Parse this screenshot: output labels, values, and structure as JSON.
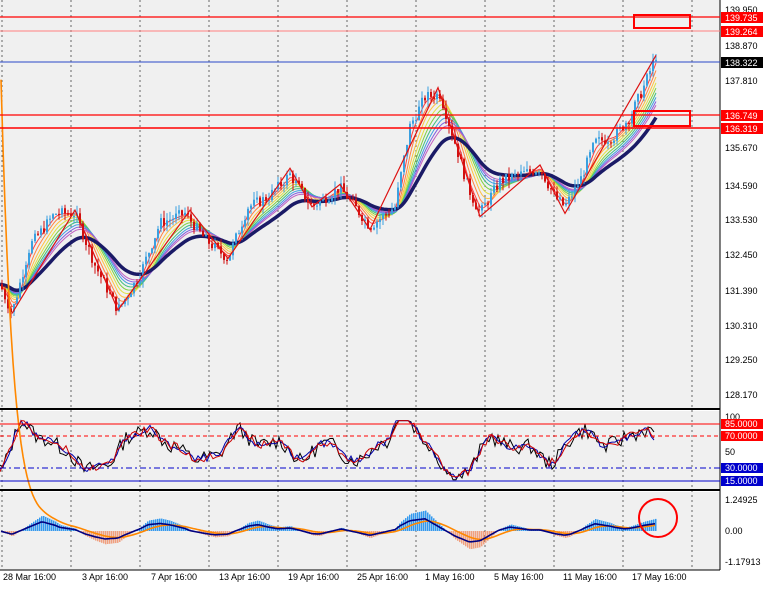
{
  "window": {
    "background": "#ffffff",
    "plot_background": "#f0f0f0",
    "separator_color": "#000000"
  },
  "main_panel": {
    "price_labels": [
      "139.950",
      "138.870",
      "137.810",
      "136.749",
      "135.670",
      "134.590",
      "133.530",
      "132.450",
      "131.390",
      "130.310",
      "129.250",
      "128.170"
    ],
    "current_price_tag": {
      "label": "138.322",
      "value": 138.322,
      "color": "#000000",
      "line_color": "#2a49c9"
    },
    "level_tags": [
      {
        "label": "139.735",
        "value": 139.735,
        "color": "#ff0000"
      },
      {
        "label": "139.264",
        "value": 139.264,
        "color": "#ff0000"
      },
      {
        "label": "136.749",
        "value": 136.749,
        "color": "#ff0000"
      },
      {
        "label": "136.319",
        "value": 136.319,
        "color": "#ff0000"
      }
    ],
    "bull_candle_color": "#3aa0e0",
    "bear_candle_color": "#d01010",
    "moving_average_color": "#1a1a66",
    "zigzag_color": "#dd1111"
  },
  "oscillator_panel": {
    "top_label": "100",
    "mid_label": "50",
    "levels": [
      {
        "label": "85.0000",
        "value": 85,
        "color": "#ff0000"
      },
      {
        "label": "70.0000",
        "value": 70,
        "color": "#ff0000"
      },
      {
        "label": "30.0000",
        "value": 30,
        "color": "#0000cc"
      },
      {
        "label": "15.0000",
        "value": 15,
        "color": "#0000cc"
      }
    ],
    "line_colors": [
      "#000000",
      "#0000aa",
      "#cc0000"
    ]
  },
  "histogram_panel": {
    "top_label": "1.24925",
    "zero_label": "0.00",
    "bottom_label": "-1.17913",
    "positive_color": "#3399ee",
    "negative_color": "#f0a080",
    "signal_color": "#ff8800",
    "main_line_color": "#000080"
  },
  "time_axis": {
    "labels": [
      "28 Mar 16:00",
      "3 Apr 16:00",
      "7 Apr 16:00",
      "13 Apr 16:00",
      "19 Apr 16:00",
      "25 Apr 16:00",
      "1 May 16:00",
      "5 May 16:00",
      "11 May 16:00",
      "17 May 16:00"
    ]
  }
}
